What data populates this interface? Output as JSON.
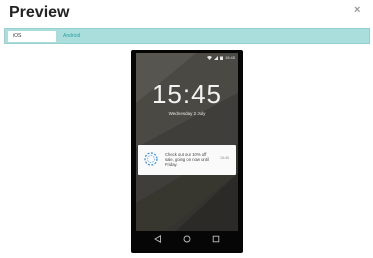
{
  "dialog": {
    "title": "Preview",
    "close_symbol": "×"
  },
  "tabs": [
    {
      "label": "iOS",
      "selected": true
    },
    {
      "label": "Android",
      "selected": false
    }
  ],
  "lockscreen": {
    "status_time": "15:45",
    "clock": "15:45",
    "date": "Wednesday 2 July",
    "notification": {
      "message": "Check out our 10% off sale, going on now until Friday.",
      "time": "15:45",
      "icon": "swirl-logo-icon"
    },
    "nav_icons": [
      "back-icon",
      "home-icon",
      "recents-icon"
    ]
  },
  "colors": {
    "tabbar_bg": "#a9dedd",
    "android_tab_text": "#2aa1a0"
  }
}
